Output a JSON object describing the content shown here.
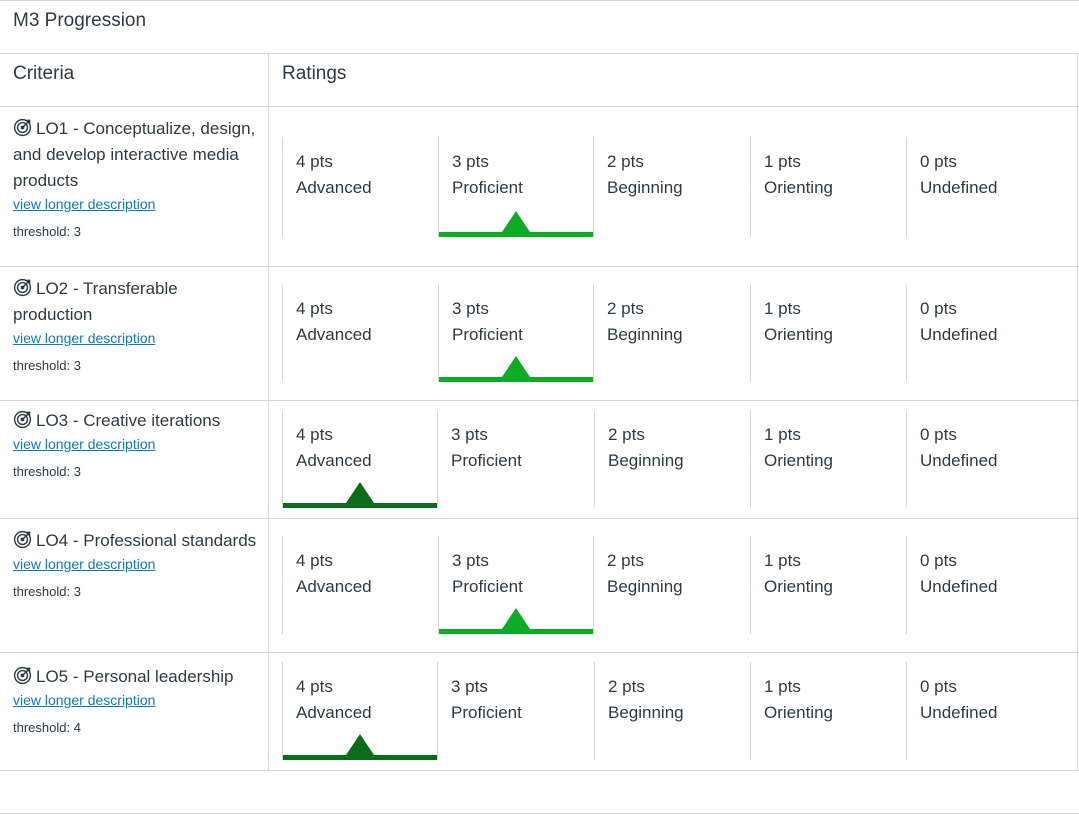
{
  "title": "M3 Progression",
  "headers": {
    "criteria": "Criteria",
    "ratings": "Ratings"
  },
  "colors": {
    "selected_light": "#0bab26",
    "selected_dark": "#0a6b18",
    "link": "#0e7ab8",
    "border": "#d7d7d7"
  },
  "rating_levels": [
    {
      "pts": "4 pts",
      "label": "Advanced"
    },
    {
      "pts": "3 pts",
      "label": "Proficient"
    },
    {
      "pts": "2 pts",
      "label": "Beginning"
    },
    {
      "pts": "1 pts",
      "label": "Orienting"
    },
    {
      "pts": "0 pts",
      "label": "Undefined"
    }
  ],
  "criteria": [
    {
      "icon": "outcome-target-icon",
      "title": "LO1 - Conceptualize, design, and develop interactive media products",
      "link": "view longer description",
      "threshold": "threshold: 3",
      "selected_index": 1,
      "selected_style": "light"
    },
    {
      "icon": "outcome-target-icon",
      "title": "LO2 - Transferable production",
      "link": "view longer description",
      "threshold": "threshold: 3",
      "selected_index": 1,
      "selected_style": "light"
    },
    {
      "icon": "outcome-target-icon",
      "title": "LO3 - Creative iterations",
      "link": "view longer description",
      "threshold": "threshold: 3",
      "selected_index": 0,
      "selected_style": "dark"
    },
    {
      "icon": "outcome-target-icon",
      "title": "LO4 - Professional standards",
      "link": "view longer description",
      "threshold": "threshold: 3",
      "selected_index": 1,
      "selected_style": "light"
    },
    {
      "icon": "outcome-target-icon",
      "title": "LO5 - Personal leadership",
      "link": "view longer description",
      "threshold": "threshold: 4",
      "selected_index": 0,
      "selected_style": "dark"
    }
  ]
}
